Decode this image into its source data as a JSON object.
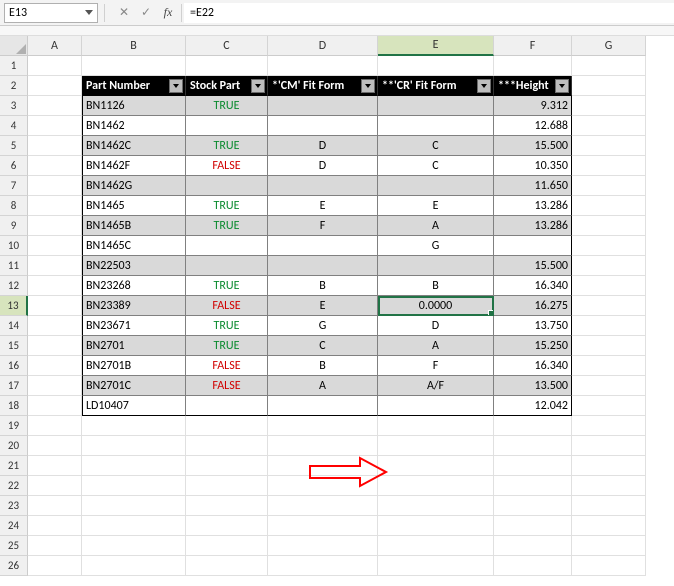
{
  "nameBox": {
    "value": "E13"
  },
  "formulaBar": {
    "cancel": "✕",
    "confirm": "✓",
    "fx": "fx",
    "formula": "=E22"
  },
  "columns": [
    "A",
    "B",
    "C",
    "D",
    "E",
    "F",
    "G"
  ],
  "colWidths": {
    "A": 54,
    "B": 104,
    "C": 82,
    "D": 110,
    "E": 116,
    "F": 78,
    "G": 74
  },
  "rowCount": 26,
  "selectedCell": {
    "row": 13,
    "colIdx": 4
  },
  "headers": {
    "partNumber": "Part Number",
    "stockPart": "Stock Part",
    "cmFit": "*'CM' Fit Form",
    "crFit": "**'CR' Fit Form",
    "height": "***Height"
  },
  "chart_data": {
    "type": "table",
    "title": "",
    "columns": [
      "Part Number",
      "Stock Part",
      "*'CM' Fit Form",
      "**'CR' Fit Form",
      "***Height"
    ],
    "rows": [
      {
        "r": 3,
        "pn": "BN1126",
        "sp": "TRUE",
        "cm": "",
        "cr": "",
        "ht": "9.312"
      },
      {
        "r": 4,
        "pn": "BN1462",
        "sp": "",
        "cm": "",
        "cr": "",
        "ht": "12.688"
      },
      {
        "r": 5,
        "pn": "BN1462C",
        "sp": "TRUE",
        "cm": "D",
        "cr": "C",
        "ht": "15.500"
      },
      {
        "r": 6,
        "pn": "BN1462F",
        "sp": "FALSE",
        "cm": "D",
        "cr": "C",
        "ht": "10.350"
      },
      {
        "r": 7,
        "pn": "BN1462G",
        "sp": "",
        "cm": "",
        "cr": "",
        "ht": "11.650"
      },
      {
        "r": 8,
        "pn": "BN1465",
        "sp": "TRUE",
        "cm": "E",
        "cr": "E",
        "ht": "13.286"
      },
      {
        "r": 9,
        "pn": "BN1465B",
        "sp": "TRUE",
        "cm": "F",
        "cr": "A",
        "ht": "13.286"
      },
      {
        "r": 10,
        "pn": "BN1465C",
        "sp": "",
        "cm": "",
        "cr": "G",
        "ht": ""
      },
      {
        "r": 11,
        "pn": "BN22503",
        "sp": "",
        "cm": "",
        "cr": "",
        "ht": "15.500"
      },
      {
        "r": 12,
        "pn": "BN23268",
        "sp": "TRUE",
        "cm": "B",
        "cr": "B",
        "ht": "16.340"
      },
      {
        "r": 13,
        "pn": "BN23389",
        "sp": "FALSE",
        "cm": "E",
        "cr": "0.0000",
        "ht": "16.275"
      },
      {
        "r": 14,
        "pn": "BN23671",
        "sp": "TRUE",
        "cm": "G",
        "cr": "D",
        "ht": "13.750"
      },
      {
        "r": 15,
        "pn": "BN2701",
        "sp": "TRUE",
        "cm": "C",
        "cr": "A",
        "ht": "15.250"
      },
      {
        "r": 16,
        "pn": "BN2701B",
        "sp": "FALSE",
        "cm": "B",
        "cr": "F",
        "ht": "16.340"
      },
      {
        "r": 17,
        "pn": "BN2701C",
        "sp": "FALSE",
        "cm": "A",
        "cr": "A/F",
        "ht": "13.500"
      },
      {
        "r": 18,
        "pn": "LD10407",
        "sp": "",
        "cm": "",
        "cr": "",
        "ht": "12.042"
      }
    ]
  },
  "arrow": {
    "label": "arrow-annotation",
    "color": "#ff0000"
  }
}
